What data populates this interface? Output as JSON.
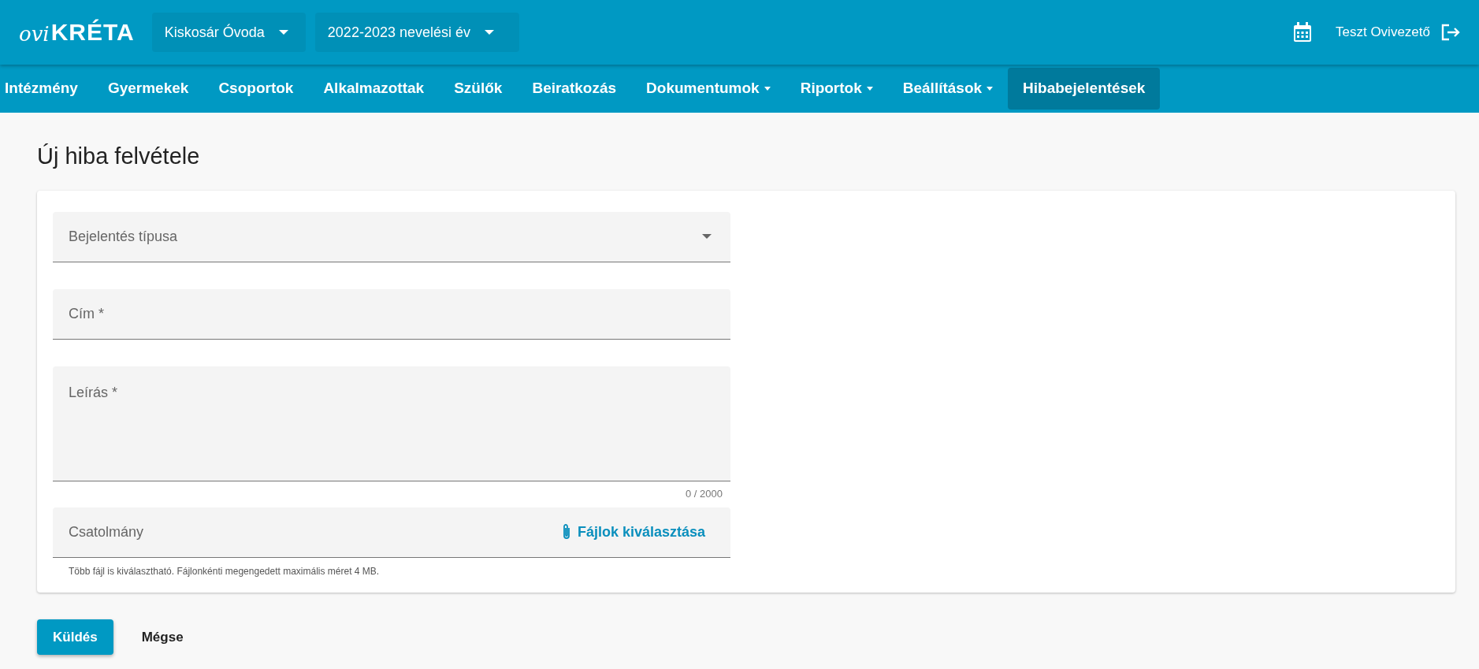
{
  "logo": {
    "prefix": "ovi",
    "name": "KRÉTA"
  },
  "header_selects": [
    {
      "value": "Kiskosár Óvoda"
    },
    {
      "value": "2022-2023 nevelési év"
    }
  ],
  "user": {
    "name": "Teszt Ovivezető"
  },
  "nav": [
    {
      "label": "Intézmény",
      "dropdown": false,
      "selected": false
    },
    {
      "label": "Gyermekek",
      "dropdown": false,
      "selected": false
    },
    {
      "label": "Csoportok",
      "dropdown": false,
      "selected": false
    },
    {
      "label": "Alkalmazottak",
      "dropdown": false,
      "selected": false
    },
    {
      "label": "Szülők",
      "dropdown": false,
      "selected": false
    },
    {
      "label": "Beiratkozás",
      "dropdown": false,
      "selected": false
    },
    {
      "label": "Dokumentumok",
      "dropdown": true,
      "selected": false
    },
    {
      "label": "Riportok",
      "dropdown": true,
      "selected": false
    },
    {
      "label": "Beállítások",
      "dropdown": true,
      "selected": false
    },
    {
      "label": "Hibabejelentések",
      "dropdown": false,
      "selected": true
    }
  ],
  "page_title": "Új hiba felvétele",
  "form": {
    "fields": [
      {
        "kind": "select",
        "placeholder": "Bejelentés típusa"
      },
      {
        "kind": "text",
        "placeholder": "Cím *"
      },
      {
        "kind": "textarea",
        "placeholder": "Leírás *",
        "counter": "0 / 2000"
      },
      {
        "kind": "file",
        "placeholder": "Csatolmány",
        "action": "Fájlok kiválasztása",
        "hint": "Több fájl is kiválasztható. Fájlonkénti megengedett maximális méret 4 MB."
      }
    ]
  },
  "buttons": [
    {
      "label": "Küldés",
      "kind": "primary"
    },
    {
      "label": "Mégse",
      "kind": "text"
    }
  ]
}
